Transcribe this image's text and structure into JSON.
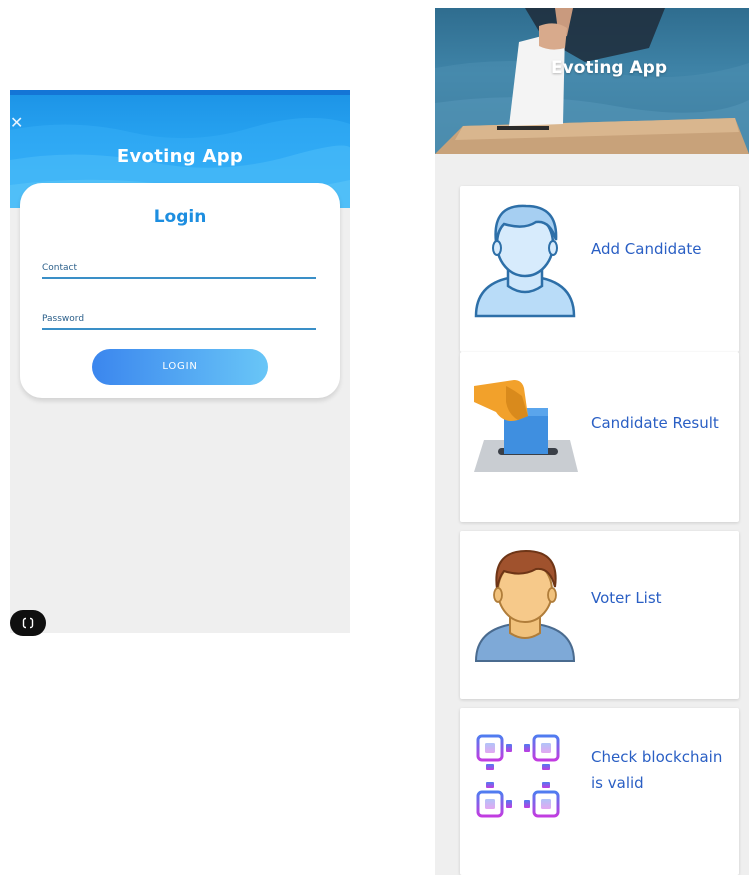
{
  "login": {
    "app_title": "Evoting App",
    "close_glyph": "✕",
    "card_title": "Login",
    "contact_label": "Contact",
    "password_label": "Password",
    "login_button": "LOGIN"
  },
  "dashboard": {
    "app_title": "Evoting App",
    "items": [
      {
        "label": "Add Candidate",
        "icon": "user-avatar-icon"
      },
      {
        "label": "Candidate Result",
        "icon": "ballot-box-icon"
      },
      {
        "label": "Voter List",
        "icon": "voter-avatar-icon"
      },
      {
        "label_line1": "Check blockchain",
        "label_line2": "is valid",
        "icon": "blockchain-icon"
      }
    ]
  },
  "colors": {
    "header_blue": "#2aa7f3",
    "accent_blue": "#1d8ee0",
    "label_blue": "#2a5fc4",
    "background": "#efefef"
  }
}
